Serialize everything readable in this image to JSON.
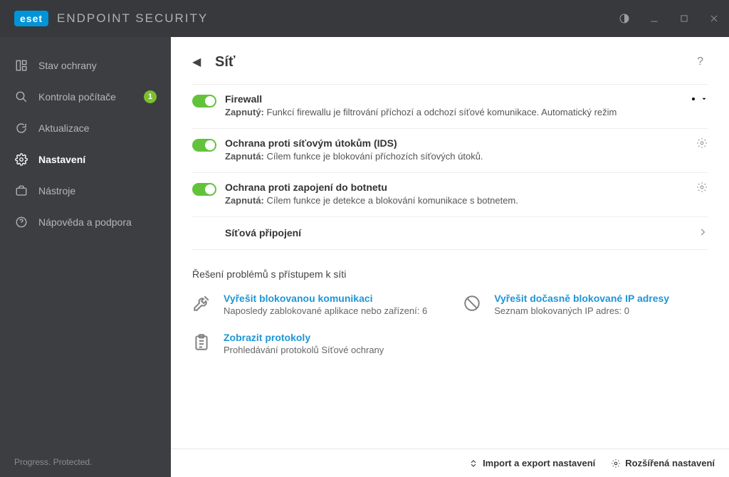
{
  "titlebar": {
    "logo": "eset",
    "app_name": "ENDPOINT SECURITY"
  },
  "sidebar": {
    "items": [
      {
        "label": "Stav ochrany",
        "badge": null
      },
      {
        "label": "Kontrola počítače",
        "badge": "1"
      },
      {
        "label": "Aktualizace",
        "badge": null
      },
      {
        "label": "Nastavení",
        "badge": null
      },
      {
        "label": "Nástroje",
        "badge": null
      },
      {
        "label": "Nápověda a podpora",
        "badge": null
      }
    ],
    "footer": "Progress. Protected."
  },
  "page": {
    "title": "Síť",
    "help": "?"
  },
  "rows": [
    {
      "title": "Firewall",
      "state_label": "Zapnutý:",
      "desc": "Funkcí firewallu je filtrování příchozí a odchozí síťové komunikace. Automatický režim",
      "dropdown": true
    },
    {
      "title": "Ochrana proti síťovým útokům (IDS)",
      "state_label": "Zapnutá:",
      "desc": "Cílem funkce je blokování příchozích síťových útoků.",
      "dropdown": false
    },
    {
      "title": "Ochrana proti zapojení do botnetu",
      "state_label": "Zapnutá:",
      "desc": "Cílem funkce je detekce a blokování komunikace s botnetem.",
      "dropdown": false
    }
  ],
  "link_row": {
    "label": "Síťová připojení"
  },
  "section_title": "Řešení problémů s přístupem k síti",
  "trouble": {
    "left": [
      {
        "title": "Vyřešit blokovanou komunikaci",
        "sub": "Naposledy zablokované aplikace nebo zařízení: 6"
      },
      {
        "title": "Zobrazit protokoly",
        "sub": "Prohledávání protokolů Síťové ochrany"
      }
    ],
    "right": [
      {
        "title": "Vyřešit dočasně blokované IP adresy",
        "sub": "Seznam blokovaných IP adres: 0"
      }
    ]
  },
  "bottombar": {
    "import": "Import a export nastavení",
    "advanced": "Rozšířená nastavení"
  }
}
